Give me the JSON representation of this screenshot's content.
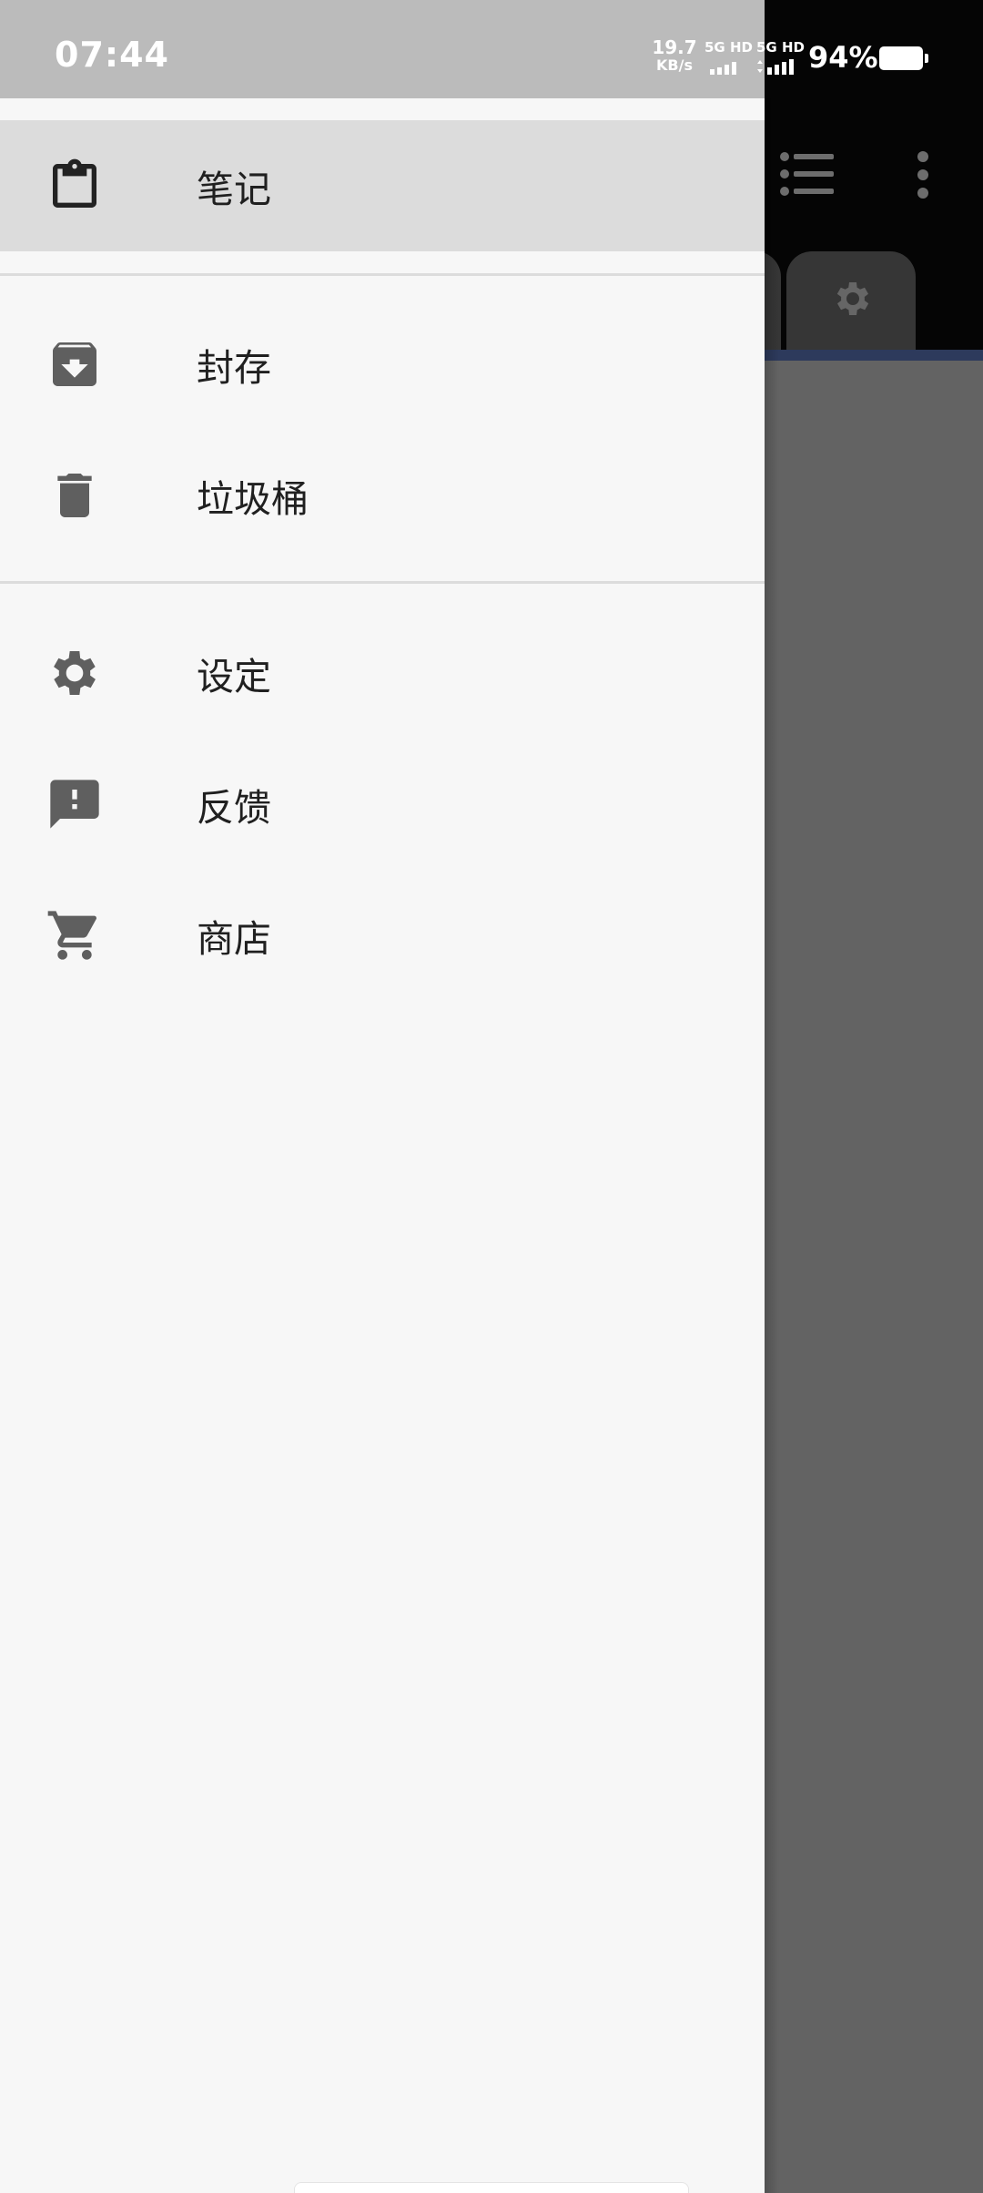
{
  "status_bar": {
    "time": "07:44",
    "net_speed": "19.7",
    "net_speed_unit": "KB/s",
    "sim1": "5G HD",
    "sim2": "5G HD",
    "battery_percent": "94%"
  },
  "drawer": {
    "items": [
      {
        "label": "笔记",
        "icon": "clipboard-icon",
        "selected": true
      },
      {
        "label": "封存",
        "icon": "archive-icon",
        "selected": false
      },
      {
        "label": "垃圾桶",
        "icon": "trash-icon",
        "selected": false
      },
      {
        "label": "设定",
        "icon": "gear-icon",
        "selected": false
      },
      {
        "label": "反馈",
        "icon": "feedback-icon",
        "selected": false
      },
      {
        "label": "商店",
        "icon": "cart-icon",
        "selected": false
      }
    ]
  },
  "background_app": {
    "icons": [
      "list-view-icon",
      "more-vert-icon",
      "gear-icon"
    ]
  },
  "colors": {
    "drawer_bg": "#f7f7f7",
    "selected_bg": "#dcdcdc",
    "icon": "#5f5f5f",
    "scrim": "#636363",
    "accent_line": "#2d3a5c"
  }
}
